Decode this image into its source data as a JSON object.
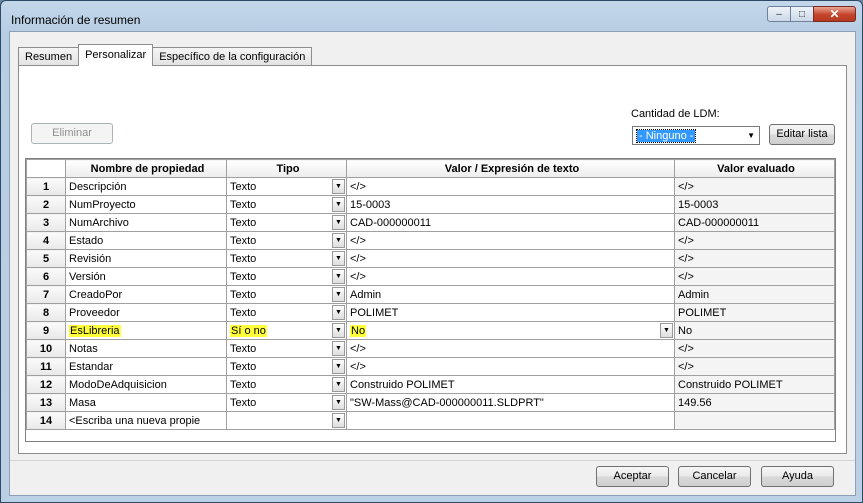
{
  "window": {
    "title": "Información de resumen",
    "buttons": {
      "minimize": "–",
      "maximize": "□",
      "close": "✕"
    }
  },
  "tabs": [
    {
      "label": "Resumen",
      "active": false
    },
    {
      "label": "Personalizar",
      "active": true
    },
    {
      "label": "Específico de la configuración",
      "active": false
    }
  ],
  "toolbar": {
    "delete_label": "Eliminar",
    "bom_qty_label": "Cantidad de LDM:",
    "bom_qty_value": "- Ninguno -",
    "edit_list_label": "Editar lista"
  },
  "grid": {
    "columns": [
      "Nombre de propiedad",
      "Tipo",
      "Valor / Expresión de texto",
      "Valor evaluado"
    ],
    "rows": [
      {
        "num": "1",
        "name": "Descripción",
        "type": "Texto",
        "value": "</>",
        "evaluated": "</>"
      },
      {
        "num": "2",
        "name": "NumProyecto",
        "type": "Texto",
        "value": "15-0003",
        "evaluated": "15-0003"
      },
      {
        "num": "3",
        "name": "NumArchivo",
        "type": "Texto",
        "value": "CAD-000000011",
        "evaluated": "CAD-000000011"
      },
      {
        "num": "4",
        "name": "Estado",
        "type": "Texto",
        "value": "</>",
        "evaluated": "</>"
      },
      {
        "num": "5",
        "name": "Revisión",
        "type": "Texto",
        "value": "</>",
        "evaluated": "</>"
      },
      {
        "num": "6",
        "name": "Versión",
        "type": "Texto",
        "value": "</>",
        "evaluated": "</>"
      },
      {
        "num": "7",
        "name": "CreadoPor",
        "type": "Texto",
        "value": "Admin",
        "evaluated": "Admin"
      },
      {
        "num": "8",
        "name": "Proveedor",
        "type": "Texto",
        "value": "POLIMET",
        "evaluated": "POLIMET"
      },
      {
        "num": "9",
        "name": "EsLibreria",
        "type": "Sí o no",
        "value": "No",
        "evaluated": "No",
        "highlight": true,
        "value_dropdown": true
      },
      {
        "num": "10",
        "name": "Notas",
        "type": "Texto",
        "value": "</>",
        "evaluated": "</>"
      },
      {
        "num": "11",
        "name": "Estandar",
        "type": "Texto",
        "value": "</>",
        "evaluated": "</>"
      },
      {
        "num": "12",
        "name": "ModoDeAdquisicion",
        "type": "Texto",
        "value": "Construido POLIMET",
        "evaluated": "Construido POLIMET"
      },
      {
        "num": "13",
        "name": "Masa",
        "type": "Texto",
        "value": "\"SW-Mass@CAD-000000011.SLDPRT\"",
        "evaluated": "149.56"
      },
      {
        "num": "14",
        "name": "<Escriba una nueva propie",
        "type": "",
        "value": "",
        "evaluated": ""
      }
    ]
  },
  "footer": {
    "ok_label": "Aceptar",
    "cancel_label": "Cancelar",
    "help_label": "Ayuda"
  },
  "colors": {
    "highlight": "#ffff3a",
    "selection": "#3399ff"
  },
  "icons": {
    "dropdown": "chevron-down-icon"
  }
}
